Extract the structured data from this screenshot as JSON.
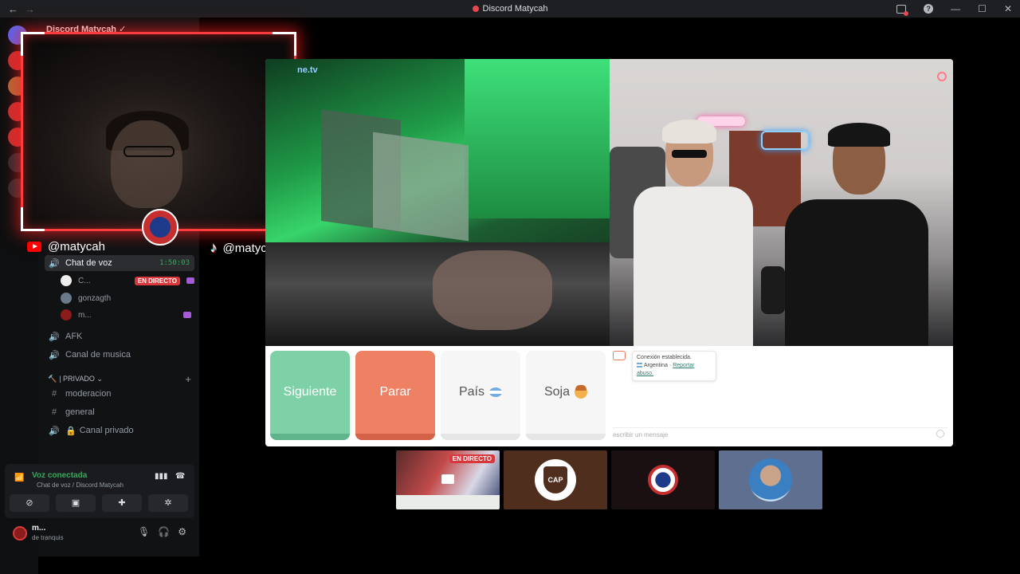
{
  "window": {
    "title": "Discord Matycah",
    "nav_back": "←",
    "nav_forward": "→",
    "controls": {
      "minimize": "—",
      "maximize": "☐",
      "close": "✕",
      "help": "?"
    }
  },
  "server": {
    "name": "Discord Matycah ✓"
  },
  "handles": {
    "youtube": "@matycah",
    "tiktok": "@matycah"
  },
  "channels": {
    "voice_active": {
      "label": "Chat de voz",
      "timer": "1:50:03"
    },
    "voice_users": [
      {
        "name": "C...",
        "live": "EN DIRECTO"
      },
      {
        "name": "gonzagth"
      },
      {
        "name": "m..."
      }
    ],
    "afk": "AFK",
    "music": "Canal de musica",
    "category_private": "| PRIVADO ⌄",
    "moderation": "moderacion",
    "general": "general",
    "private_channel": "Canal privado"
  },
  "voice_panel": {
    "title": "Voz conectada",
    "subtitle": "Chat de voz / Discord Matycah"
  },
  "user_panel": {
    "name": "m...",
    "status": "de tranquis"
  },
  "stream": {
    "watermark": "ne.tv",
    "buttons": {
      "next": "Siguiente",
      "stop": "Parar",
      "country": "País",
      "soja": "Soja"
    },
    "chat": {
      "line1": "Conexión establecida.",
      "country": "Argentina",
      "report": "Reportar abuso.",
      "placeholder": "escribir un mensaje"
    }
  },
  "thumbnails": {
    "live_badge": "EN DIRECTO",
    "club": "CAP"
  },
  "colors": {
    "accent_red": "#ff3b3b",
    "next_green": "#7ed1a7",
    "stop_orange": "#ee8064",
    "voice_green": "#3ba55d"
  }
}
